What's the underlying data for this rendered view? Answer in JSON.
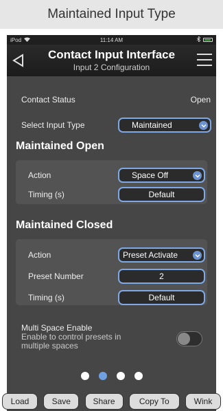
{
  "caption": "Maintained Input Type",
  "statusbar": {
    "carrier": "iPod",
    "time": "11:14 AM"
  },
  "header": {
    "title": "Contact Input Interface",
    "subtitle": "Input 2 Configuration"
  },
  "contact_status": {
    "label": "Contact Status",
    "value": "Open"
  },
  "select_input_type": {
    "label": "Select Input Type",
    "value": "Maintained"
  },
  "maintained_open": {
    "title": "Maintained Open",
    "action": {
      "label": "Action",
      "value": "Space Off"
    },
    "timing": {
      "label": "Timing (s)",
      "value": "Default"
    }
  },
  "maintained_closed": {
    "title": "Maintained Closed",
    "action": {
      "label": "Action",
      "value": "Preset Activate"
    },
    "preset_number": {
      "label": "Preset Number",
      "value": "2"
    },
    "timing": {
      "label": "Timing (s)",
      "value": "Default"
    }
  },
  "multi_space": {
    "title": "Multi Space Enable",
    "description_line1": "Enable to control presets in",
    "description_line2": "multiple spaces",
    "enabled": false
  },
  "pager": {
    "count": 4,
    "active_index": 1
  },
  "toolbar": {
    "load": "Load",
    "save": "Save",
    "share": "Share",
    "copy_to": "Copy To",
    "wink": "Wink"
  },
  "colors": {
    "accent": "#7fa9e6",
    "panel": "#464646",
    "header": "#1f1f1f"
  }
}
